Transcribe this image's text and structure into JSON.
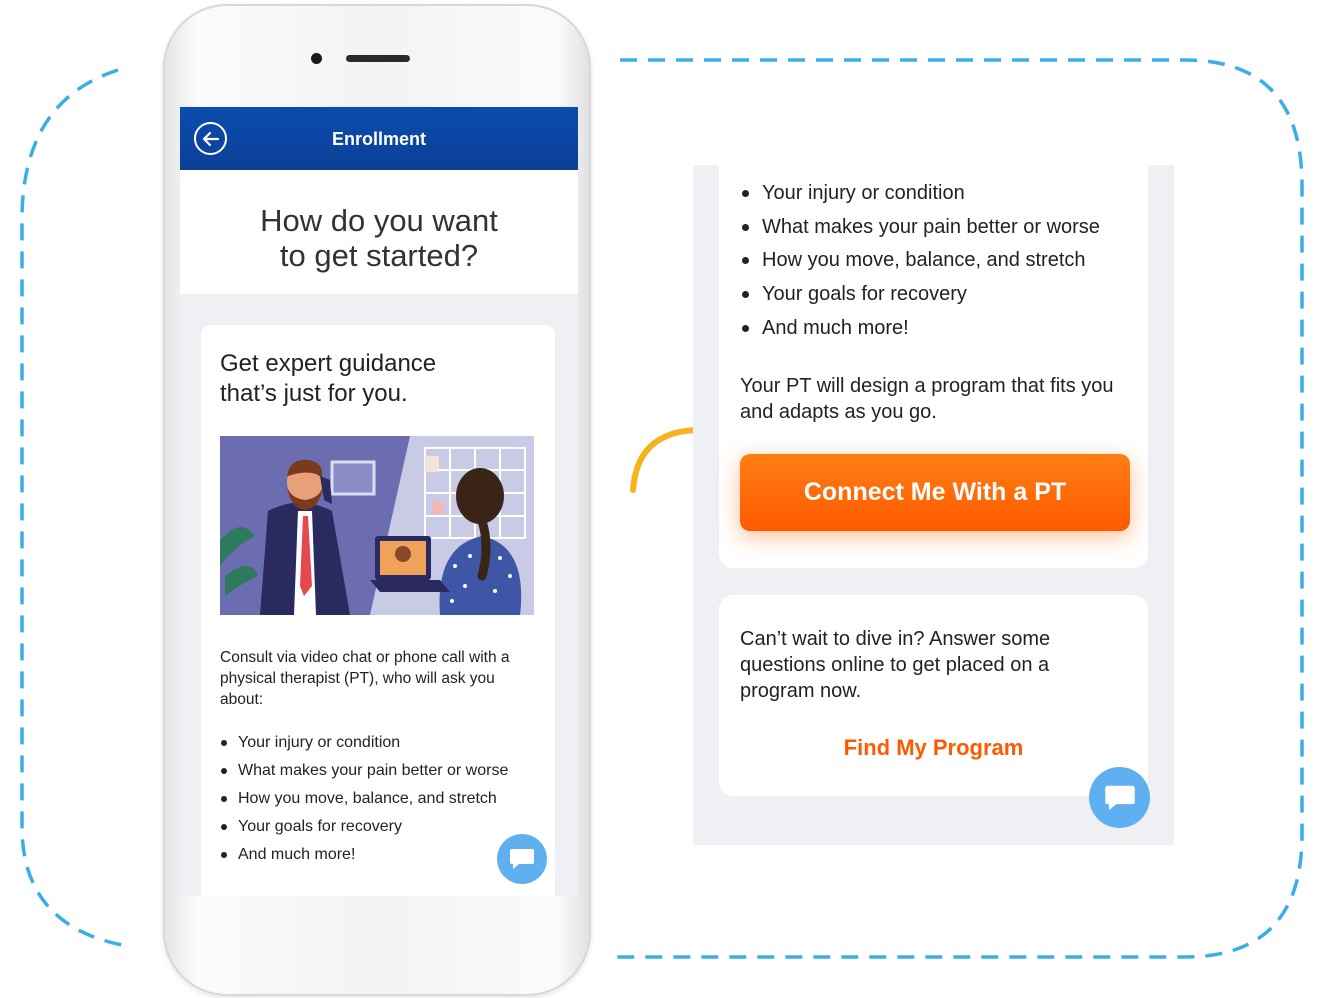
{
  "app": {
    "header_title": "Enrollment",
    "screen_heading_line1": "How do you want",
    "screen_heading_line2": "to get started?"
  },
  "card": {
    "title_line1": "Get expert guidance",
    "title_line2": "that’s just for you.",
    "description": "Consult via video chat or phone call with a physical therapist (PT), who will ask you about:",
    "bullets": [
      "Your injury or condition",
      "What makes your pain better or worse",
      "How you move, balance, and stretch",
      "Your goals for recovery",
      "And much more!"
    ]
  },
  "zoom": {
    "bullets": [
      "Your injury or condition",
      "What makes your pain better or worse",
      "How you move, balance, and stretch",
      "Your goals for recovery",
      "And much more!"
    ],
    "program_text": "Your PT will design a program that fits you and adapts as you go.",
    "cta_label": "Connect Me With a PT",
    "dive_in_text": "Can’t wait to dive in? Answer some questions online to get placed on a program now.",
    "find_program_label": "Find My Program"
  },
  "icons": {
    "back": "back-arrow-circle-icon",
    "chat": "chat-bubble-icon",
    "pointer": "curved-arrow-icon"
  },
  "colors": {
    "header_blue": "#0d47a1",
    "cta_orange": "#ff6a00",
    "link_orange": "#ff5a00",
    "chat_blue": "#5fb0f0",
    "dashed_frame": "#3aaee6",
    "arrow_yellow": "#f5b41e",
    "screen_bg": "#eef0f4"
  }
}
